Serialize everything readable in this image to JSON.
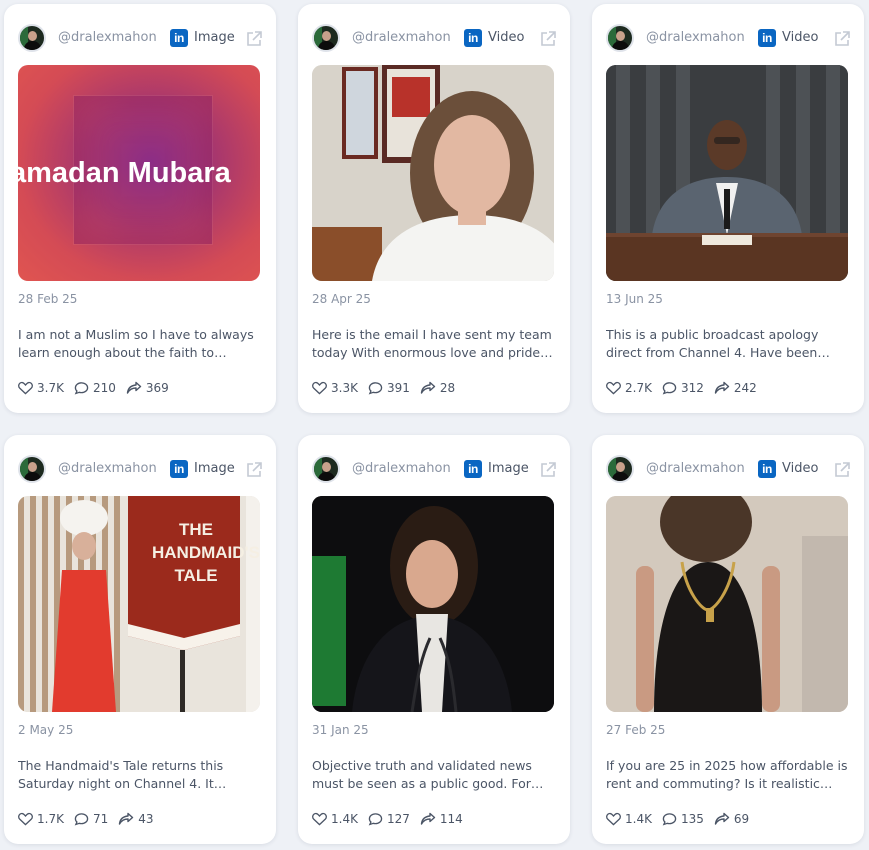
{
  "colors": {
    "page_bg": "#eef1f6",
    "card_bg": "#ffffff",
    "linkedin_blue": "#0a66c2",
    "muted_text": "#8a93a3",
    "body_text": "#4b5566"
  },
  "icons": {
    "platform": "linkedin-icon",
    "external": "external-link-icon",
    "likes": "heart-icon",
    "comments": "comment-icon",
    "shares": "share-icon"
  },
  "posts": [
    {
      "handle": "@dralexmahon",
      "platform_logo": "in",
      "media_type": "Image",
      "thumbnail_text": "amadan Mubara",
      "date": "28 Feb 25",
      "caption": "I am not a Muslim so I have to always learn enough about the faith to make…",
      "likes": "3.7K",
      "comments": "210",
      "shares": "369"
    },
    {
      "handle": "@dralexmahon",
      "platform_logo": "in",
      "media_type": "Video",
      "date": "28 Apr 25",
      "caption": "Here is the email I have sent my team today With enormous love and pride…",
      "likes": "3.3K",
      "comments": "391",
      "shares": "28"
    },
    {
      "handle": "@dralexmahon",
      "platform_logo": "in",
      "media_type": "Video",
      "date": "13 Jun 25",
      "caption": "This is a public broadcast apology direct from Channel 4.   Have been keeping…",
      "likes": "2.7K",
      "comments": "312",
      "shares": "242"
    },
    {
      "handle": "@dralexmahon",
      "platform_logo": "in",
      "media_type": "Image",
      "thumbnail_text": "THE HANDMAID'S TALE",
      "date": "2 May 25",
      "caption": "The Handmaid's Tale returns this Saturday night on Channel 4. It couldn't…",
      "likes": "1.7K",
      "comments": "71",
      "shares": "43"
    },
    {
      "handle": "@dralexmahon",
      "platform_logo": "in",
      "media_type": "Image",
      "date": "31 Jan 25",
      "caption": "Objective truth and validated news must be seen as a public good. For Gen Z,…",
      "likes": "1.4K",
      "comments": "127",
      "shares": "114"
    },
    {
      "handle": "@dralexmahon",
      "platform_logo": "in",
      "media_type": "Video",
      "date": "27 Feb 25",
      "caption": "If you are 25 in 2025 how affordable is rent and commuting? Is it realistic for…",
      "likes": "1.4K",
      "comments": "135",
      "shares": "69"
    }
  ]
}
